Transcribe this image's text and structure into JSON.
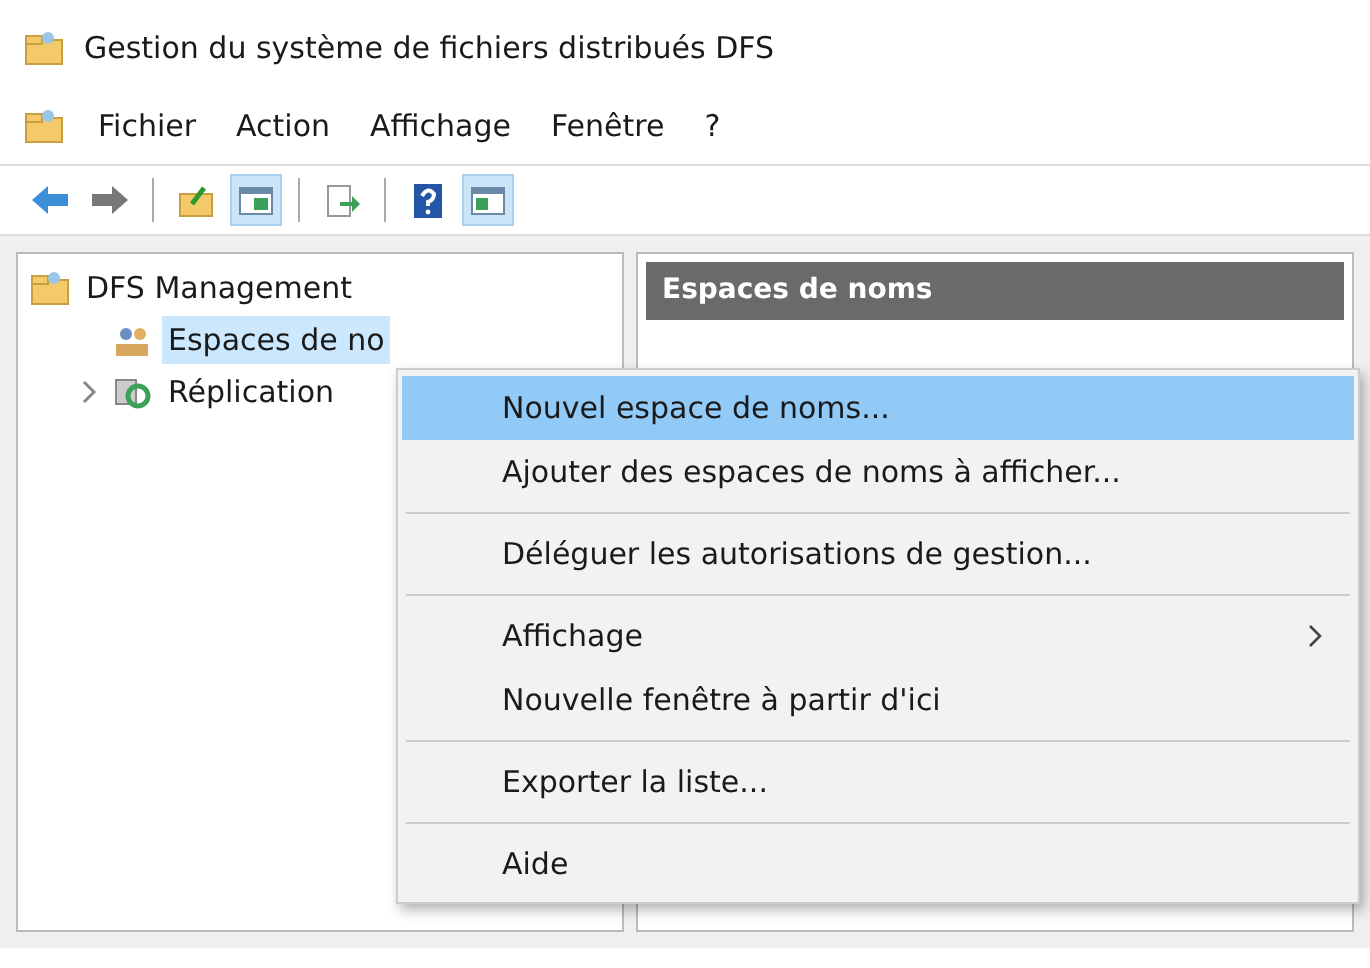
{
  "window": {
    "title": "Gestion du système de fichiers distribués DFS"
  },
  "menu_bar": [
    "Fichier",
    "Action",
    "Affichage",
    "Fenêtre",
    "?"
  ],
  "toolbar": [
    {
      "kind": "back",
      "pressed": false
    },
    {
      "kind": "forward",
      "pressed": false
    },
    {
      "kind": "separator"
    },
    {
      "kind": "folder-up",
      "pressed": false
    },
    {
      "kind": "tree-toggle",
      "pressed": true
    },
    {
      "kind": "separator"
    },
    {
      "kind": "export",
      "pressed": false
    },
    {
      "kind": "separator"
    },
    {
      "kind": "help",
      "pressed": false
    },
    {
      "kind": "action-pane",
      "pressed": true
    }
  ],
  "tree": {
    "items": [
      {
        "kind": "root",
        "label": "DFS Management",
        "selected": false,
        "children": [
          {
            "kind": "namespace",
            "label": "Espaces de no",
            "selected": true
          },
          {
            "kind": "replication",
            "label": "Réplication",
            "expanded": false,
            "selected": false
          }
        ]
      }
    ]
  },
  "content_pane": {
    "header": "Espaces de noms"
  },
  "context_menu": {
    "items": [
      {
        "kind": "item",
        "label": "Nouvel espace de noms...",
        "selected": true,
        "submenu": false
      },
      {
        "kind": "item",
        "label": "Ajouter des espaces de noms à afficher...",
        "selected": false,
        "submenu": false
      },
      {
        "kind": "separator"
      },
      {
        "kind": "item",
        "label": "Déléguer les autorisations de gestion...",
        "selected": false,
        "submenu": false
      },
      {
        "kind": "separator"
      },
      {
        "kind": "item",
        "label": "Affichage",
        "selected": false,
        "submenu": true
      },
      {
        "kind": "item",
        "label": "Nouvelle fenêtre à partir d'ici",
        "selected": false,
        "submenu": false
      },
      {
        "kind": "separator"
      },
      {
        "kind": "item",
        "label": "Exporter la liste...",
        "selected": false,
        "submenu": false
      },
      {
        "kind": "separator"
      },
      {
        "kind": "item",
        "label": "Aide",
        "selected": false,
        "submenu": false
      }
    ]
  }
}
